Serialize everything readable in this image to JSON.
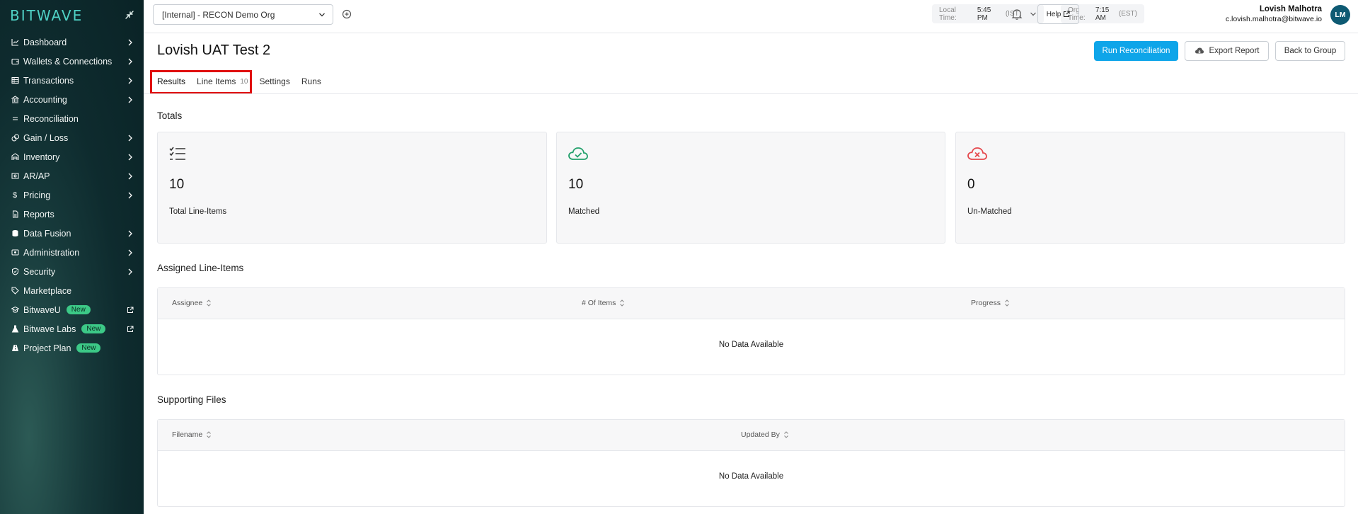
{
  "sidebar": {
    "brand": "BITWAVE",
    "items": [
      {
        "label": "Dashboard",
        "icon": "chart-line-icon",
        "chevron": true
      },
      {
        "label": "Wallets & Connections",
        "icon": "wallet-icon",
        "chevron": true
      },
      {
        "label": "Transactions",
        "icon": "list-table-icon",
        "chevron": true
      },
      {
        "label": "Accounting",
        "icon": "bank-icon",
        "chevron": true
      },
      {
        "label": "Reconciliation",
        "icon": "equals-icon",
        "chevron": false
      },
      {
        "label": "Gain / Loss",
        "icon": "coins-icon",
        "chevron": true
      },
      {
        "label": "Inventory",
        "icon": "warehouse-icon",
        "chevron": true
      },
      {
        "label": "AR/AP",
        "icon": "invoice-icon",
        "chevron": true
      },
      {
        "label": "Pricing",
        "icon": "dollar-icon",
        "chevron": true
      },
      {
        "label": "Reports",
        "icon": "file-icon",
        "chevron": false
      },
      {
        "label": "Data Fusion",
        "icon": "database-icon",
        "chevron": true
      },
      {
        "label": "Administration",
        "icon": "admin-icon",
        "chevron": true
      },
      {
        "label": "Security",
        "icon": "shield-icon",
        "chevron": true
      },
      {
        "label": "Marketplace",
        "icon": "tag-icon",
        "chevron": false
      },
      {
        "label": "BitwaveU",
        "icon": "graduation-icon",
        "badge": "New",
        "external": true
      },
      {
        "label": "Bitwave Labs",
        "icon": "flask-icon",
        "badge": "New",
        "external": true
      },
      {
        "label": "Project Plan",
        "icon": "road-icon",
        "badge": "New",
        "external": false
      }
    ]
  },
  "topbar": {
    "org": "[Internal] - RECON Demo Org",
    "local_time_label": "Local Time:",
    "local_time": "5:45 PM",
    "local_zone": "(IST)",
    "org_time_label": "Org Time:",
    "org_time": "7:15 AM",
    "org_zone": "(EST)",
    "help": "Help",
    "user_name": "Lovish Malhotra",
    "user_email": "c.lovish.malhotra@bitwave.io",
    "avatar": "LM"
  },
  "page": {
    "title": "Lovish UAT Test 2",
    "run_button": "Run Reconciliation",
    "export_button": "Export Report",
    "back_button": "Back to Group",
    "tabs": [
      {
        "label": "Results"
      },
      {
        "label": "Line Items",
        "count": "10"
      },
      {
        "label": "Settings"
      },
      {
        "label": "Runs"
      }
    ]
  },
  "totals": {
    "heading": "Totals",
    "cards": [
      {
        "value": "10",
        "label": "Total Line-Items",
        "icon": "checklist-icon"
      },
      {
        "value": "10",
        "label": "Matched",
        "icon": "cloud-check-icon",
        "color": "#22a06b"
      },
      {
        "value": "0",
        "label": "Un-Matched",
        "icon": "cloud-x-icon",
        "color": "#e5484d"
      }
    ]
  },
  "assigned": {
    "heading": "Assigned Line-Items",
    "columns": [
      "Assignee",
      "# Of Items",
      "Progress"
    ],
    "empty": "No Data Available"
  },
  "files": {
    "heading": "Supporting Files",
    "columns": [
      "Filename",
      "Updated By"
    ],
    "empty": "No Data Available"
  },
  "colors": {
    "accent": "#0ea5e9",
    "badge": "#3cc987",
    "highlight": "#e01010",
    "avatar": "#0e5a73"
  }
}
